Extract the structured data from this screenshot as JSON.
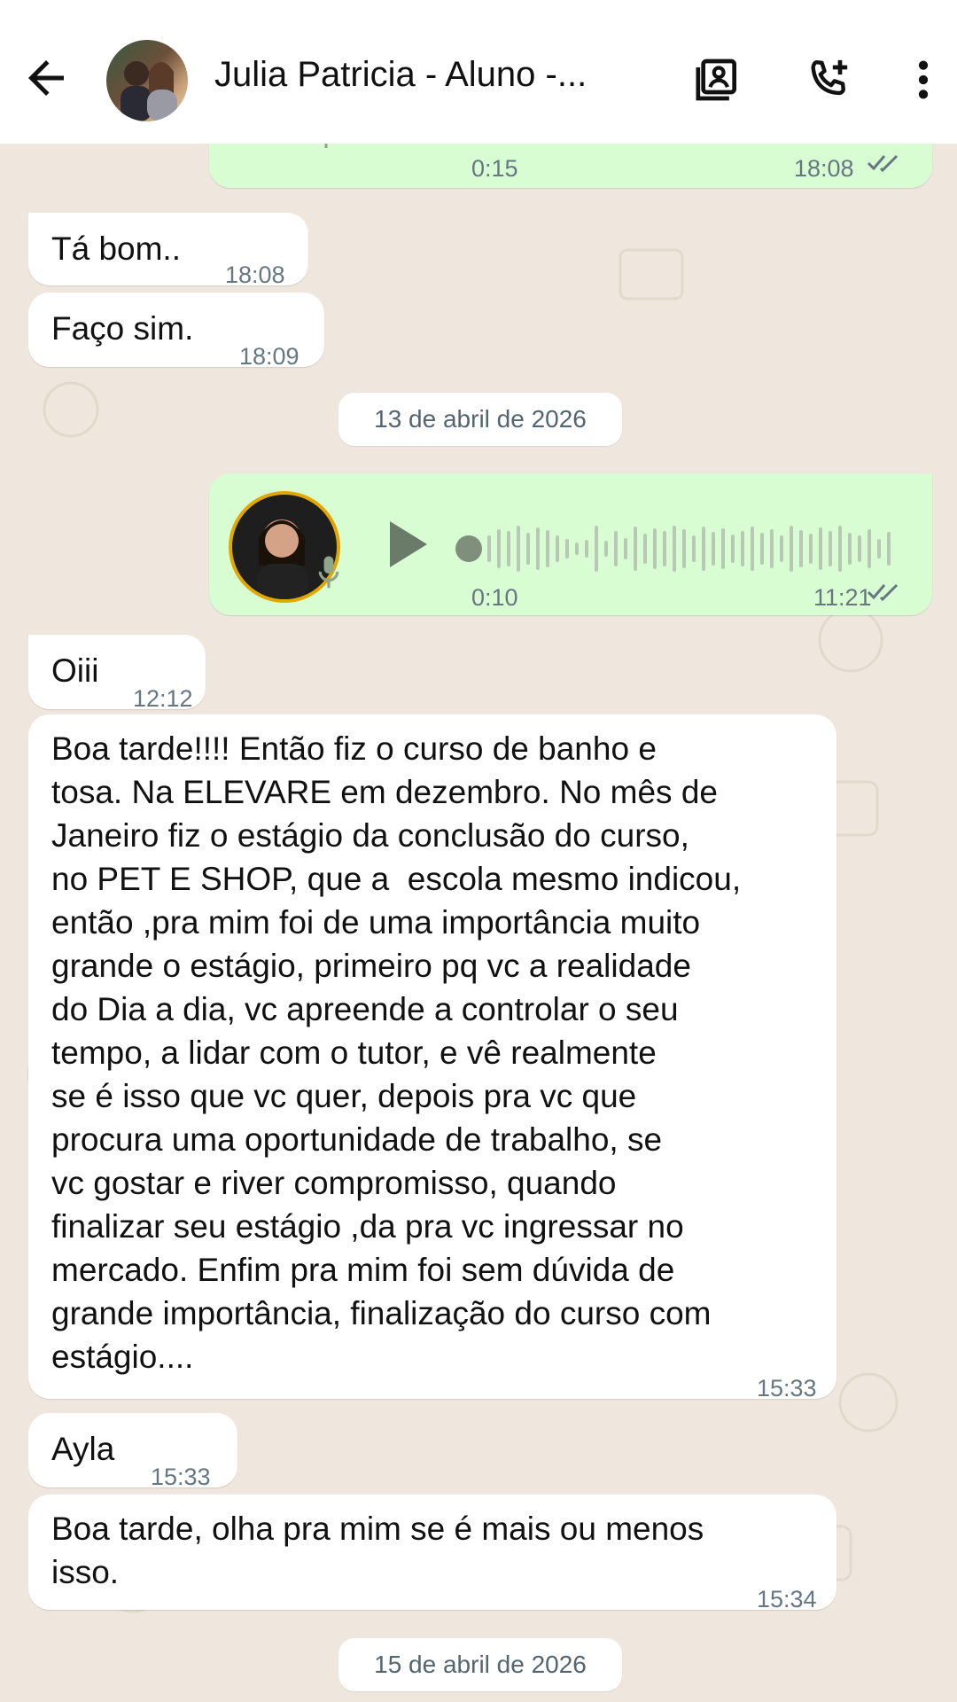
{
  "header": {
    "title": "Julia Patricia - Aluno -...",
    "icons": [
      "back-arrow-icon",
      "contact-card-icon",
      "add-call-icon",
      "more-vert-icon"
    ]
  },
  "messages": {
    "audio_top": {
      "duration": "0:15",
      "time": "18:08"
    },
    "m1": {
      "text": "Tá bom..",
      "time": "18:08"
    },
    "m2": {
      "text": "Faço sim.",
      "time": "18:09"
    },
    "date1": "13 de abril de 2026",
    "audio2": {
      "duration": "0:10",
      "time": "11:21"
    },
    "m3": {
      "text": "Oiii",
      "time": "12:12"
    },
    "m4": {
      "lines": [
        "Boa tarde!!!! Então fiz o curso de banho e",
        "tosa. Na ELEVARE em dezembro. No mês de",
        "Janeiro fiz o estágio da conclusão do curso,",
        "no PET E SHOP, que a  escola mesmo indicou,",
        "então ,pra mim foi de uma importância muito",
        "grande o estágio, primeiro pq vc a realidade",
        "do Dia a dia, vc apreende a controlar o seu",
        "tempo, a lidar com o tutor, e vê realmente",
        "se é isso que vc quer, depois pra vc que",
        "procura uma oportunidade de trabalho, se",
        "vc gostar e river compromisso, quando",
        "finalizar seu estágio ,da pra vc ingressar no",
        "mercado. Enfim pra mim foi sem dúvida de",
        "grande importância, finalização do curso com",
        "estágio...."
      ],
      "time": "15:33"
    },
    "m5": {
      "text": "Ayla",
      "time": "15:33"
    },
    "m6": {
      "lines": [
        "Boa tarde, olha pra mim se é mais ou menos",
        "isso."
      ],
      "time": "15:34"
    },
    "date2": "15 de abril de 2026"
  },
  "colors": {
    "outgoing": "#d9fdd3",
    "incoming": "#ffffff",
    "background": "#efe7dd",
    "tick": "#667781"
  }
}
